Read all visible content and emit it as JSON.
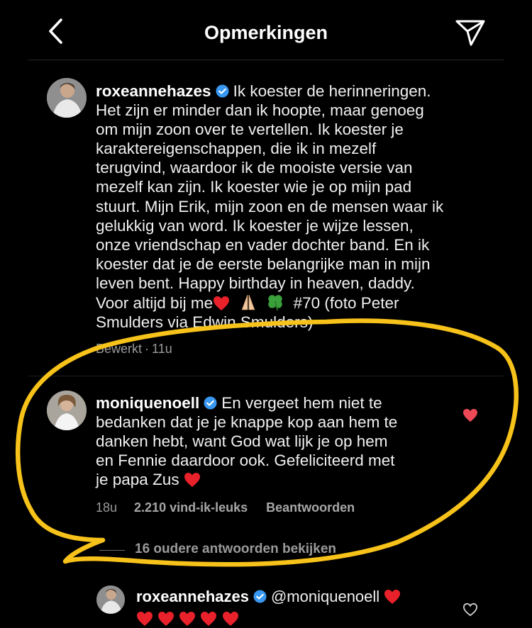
{
  "header": {
    "title": "Opmerkingen"
  },
  "post": {
    "username": "roxeannehazes",
    "caption_lines": [
      "Ik koester de herinneringen.",
      "Het zijn er minder dan ik hoopte, maar genoeg",
      "om mijn zoon over te vertellen. Ik koester je",
      "karaktereigenschappen, die ik in mezelf",
      "terugvind, waardoor ik de mooiste versie van",
      "mezelf kan zijn. Ik koester wie je op mijn pad",
      "stuurt. Mijn Erik, mijn zoon en de mensen waar ik",
      "gelukkig van word. Ik koester je wijze lessen,",
      "onze vriendschap en vader dochter band. En ik",
      "koester dat je de eerste belangrijke man in mijn",
      "leven bent. Happy birthday in heaven, daddy.",
      "Voor altijd bij me",
      "#70 (foto Peter",
      "Smulders via Edwin Smulders)"
    ],
    "edited_label": "Bewerkt",
    "time": "11u"
  },
  "comment": {
    "username": "moniquenoell",
    "text_lines": [
      "En vergeet hem niet te",
      "bedanken dat je je knappe kop aan hem te",
      "danken hebt, want God wat lijk je op hem",
      "en Fennie daardoor ook. Gefeliciteerd met",
      "je papa Zus"
    ],
    "time": "18u",
    "likes": "2.210 vind-ik-leuks",
    "reply_label": "Beantwoorden",
    "liked": true,
    "view_replies": "16 oudere antwoorden bekijken"
  },
  "reply": {
    "username": "roxeannehazes",
    "mention": "@moniquenoell"
  },
  "colors": {
    "background": "#000000",
    "verified": "#3897f0",
    "heart": "#ed4956",
    "highlight": "#f7c21a"
  }
}
